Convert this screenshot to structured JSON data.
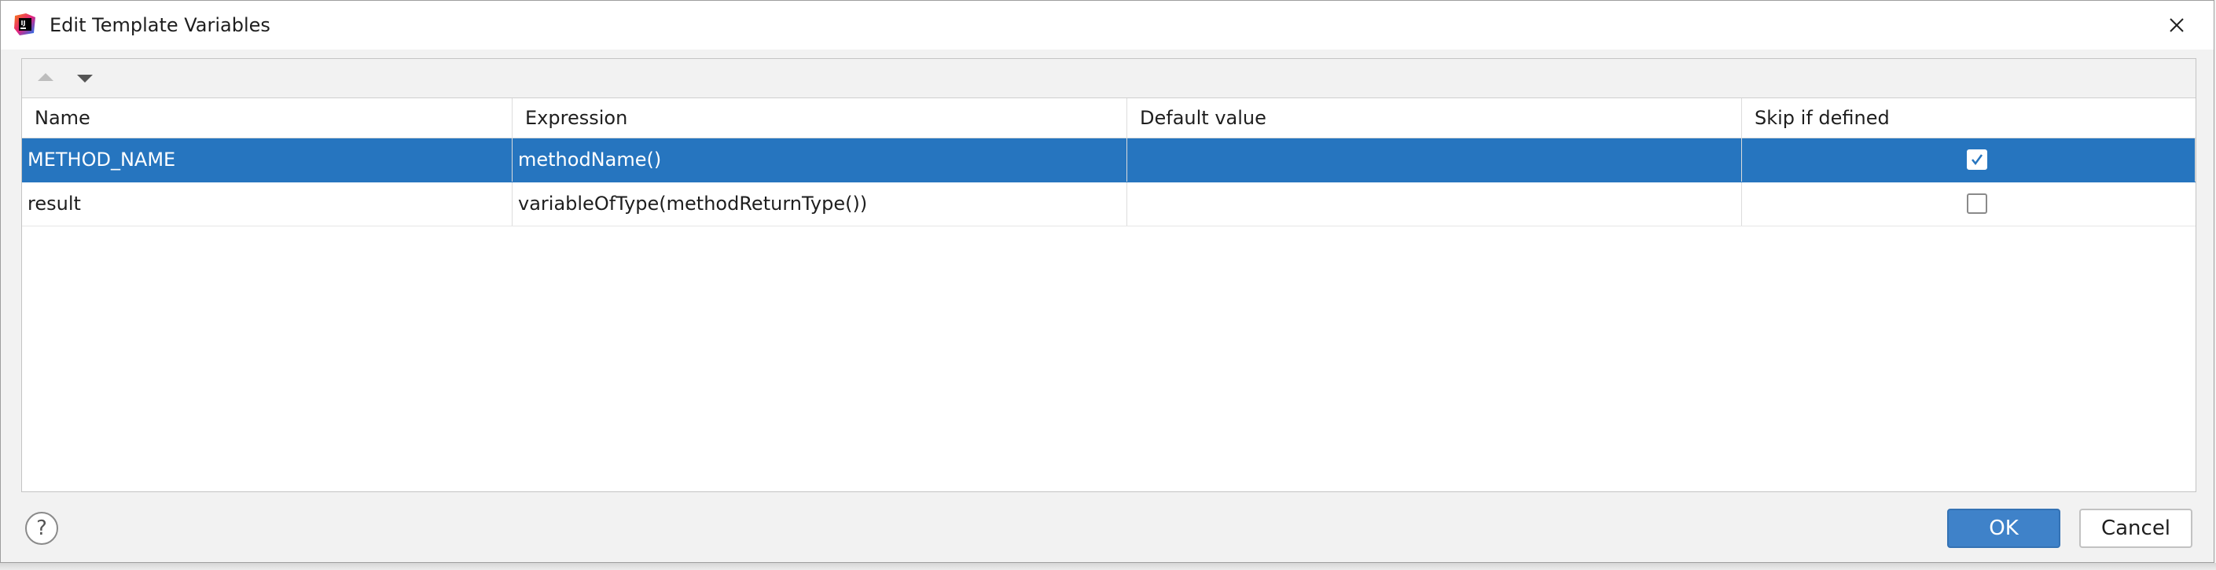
{
  "window": {
    "title": "Edit Template Variables",
    "icon": "intellij-app-icon",
    "close_icon": "close-icon"
  },
  "toolbar": {
    "move_up_icon": "arrow-up-icon",
    "move_down_icon": "arrow-down-icon"
  },
  "table": {
    "columns": [
      "Name",
      "Expression",
      "Default value",
      "Skip if defined"
    ],
    "rows": [
      {
        "name": "METHOD_NAME",
        "expression": "methodName()",
        "default_value": "",
        "skip_if_defined": true,
        "selected": true
      },
      {
        "name": "result",
        "expression": "variableOfType(methodReturnType())",
        "default_value": "",
        "skip_if_defined": false,
        "selected": false
      }
    ]
  },
  "footer": {
    "help_label": "?",
    "ok_label": "OK",
    "cancel_label": "Cancel"
  },
  "colors": {
    "selection": "#2675bf",
    "ok_button": "#3f82c9"
  }
}
